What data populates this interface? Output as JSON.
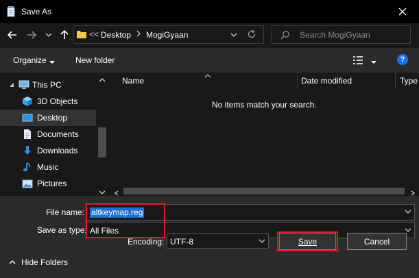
{
  "window": {
    "title": "Save As"
  },
  "address": {
    "crumbs": [
      "Desktop",
      "MogiGyaan"
    ],
    "overflow": "<<"
  },
  "search": {
    "placeholder": "Search MogiGyaan"
  },
  "toolbar": {
    "organize": "Organize",
    "new_folder": "New folder"
  },
  "nav_tree": [
    {
      "label": "This PC",
      "icon": "computer-icon"
    },
    {
      "label": "3D Objects",
      "icon": "cube-icon"
    },
    {
      "label": "Desktop",
      "icon": "desktop-icon",
      "selected": true
    },
    {
      "label": "Documents",
      "icon": "document-icon"
    },
    {
      "label": "Downloads",
      "icon": "download-arrow-icon"
    },
    {
      "label": "Music",
      "icon": "music-note-icon"
    },
    {
      "label": "Pictures",
      "icon": "picture-icon"
    }
  ],
  "file_list": {
    "columns": [
      "Name",
      "Date modified",
      "Type"
    ],
    "empty_message": "No items match your search."
  },
  "form": {
    "file_name_label": "File name:",
    "file_name_value": "altkeymap.reg",
    "save_type_label": "Save as type:",
    "save_type_value": "All Files",
    "encoding_label": "Encoding:",
    "encoding_value": "UTF-8",
    "hide_folders": "Hide Folders",
    "save": "Save",
    "cancel": "Cancel"
  },
  "colors": {
    "highlight": "#e01b24",
    "selection": "#1b6fd6",
    "background": "#191919",
    "panel": "#2b2b2b"
  }
}
